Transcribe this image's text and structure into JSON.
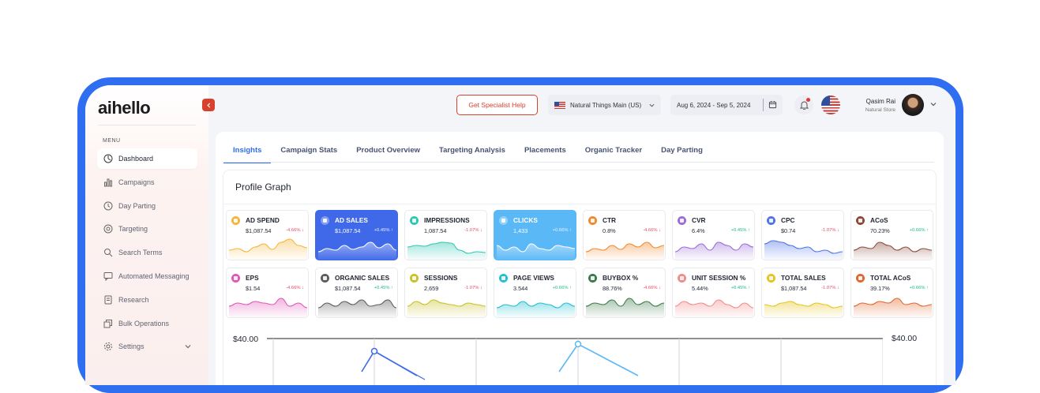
{
  "app": {
    "logo_text": "aihello",
    "collapse_icon": "chevron-left-icon"
  },
  "sidebar": {
    "menu_label": "MENU",
    "items": [
      {
        "label": "Dashboard",
        "icon": "dashboard-icon",
        "active": true
      },
      {
        "label": "Campaigns",
        "icon": "bar-chart-icon"
      },
      {
        "label": "Day Parting",
        "icon": "clock-icon"
      },
      {
        "label": "Targeting",
        "icon": "target-icon"
      },
      {
        "label": "Search Terms",
        "icon": "search-icon"
      },
      {
        "label": "Automated Messaging",
        "icon": "message-icon"
      },
      {
        "label": "Research",
        "icon": "document-icon"
      },
      {
        "label": "Bulk Operations",
        "icon": "layers-icon"
      },
      {
        "label": "Settings",
        "icon": "gear-icon",
        "expandable": true
      }
    ]
  },
  "header": {
    "help_button": "Get Specialist Help",
    "store": {
      "label": "Natural Things Main (US)"
    },
    "date_range": "Aug 6, 2024 - Sep 5, 2024",
    "user": {
      "name": "Qasim Rai",
      "store": "Natural Store"
    }
  },
  "tabs": [
    {
      "label": "Insights",
      "active": true
    },
    {
      "label": "Campaign Stats"
    },
    {
      "label": "Product Overview"
    },
    {
      "label": "Targeting Analysis"
    },
    {
      "label": "Placements"
    },
    {
      "label": "Organic Tracker"
    },
    {
      "label": "Day Parting"
    }
  ],
  "profile_graph": {
    "title": "Profile Graph",
    "metrics": [
      {
        "name": "AD SPEND",
        "value": "$1,087.54",
        "change": "-4.66%",
        "dir": "down",
        "color": "#f5b63b",
        "spark": [
          12,
          14,
          10,
          16,
          20,
          13,
          22,
          26,
          18,
          15
        ]
      },
      {
        "name": "AD SALES",
        "value": "$1,087.54",
        "change": "+0.45%",
        "dir": "up",
        "color": "#ffffff",
        "selected": "blue",
        "spark": [
          10,
          14,
          12,
          18,
          13,
          16,
          22,
          15,
          20,
          12
        ]
      },
      {
        "name": "IMPRESSIONS",
        "value": "1,087.54",
        "change": "-1.07%",
        "dir": "down",
        "color": "#2fc7b3",
        "spark": [
          16,
          18,
          17,
          20,
          22,
          21,
          12,
          8,
          10,
          9
        ]
      },
      {
        "name": "CLICKS",
        "value": "1,433",
        "change": "+0.66%",
        "dir": "up",
        "color": "#ffffff",
        "selected": "light",
        "spark": [
          18,
          12,
          16,
          10,
          20,
          14,
          12,
          18,
          16,
          14
        ]
      },
      {
        "name": "CTR",
        "value": "0.8%",
        "change": "-4.66%",
        "dir": "down",
        "color": "#f08a30",
        "spark": [
          10,
          14,
          12,
          18,
          13,
          20,
          16,
          22,
          15,
          18
        ]
      },
      {
        "name": "CVR",
        "value": "6.4%",
        "change": "+0.45%",
        "dir": "up",
        "color": "#9a6cd6",
        "spark": [
          10,
          16,
          14,
          20,
          12,
          22,
          18,
          12,
          20,
          16
        ]
      },
      {
        "name": "CPC",
        "value": "$0.74",
        "change": "-1.07%",
        "dir": "down",
        "color": "#4f74e8",
        "spark": [
          20,
          24,
          22,
          18,
          14,
          16,
          10,
          12,
          8,
          10
        ]
      },
      {
        "name": "ACoS",
        "value": "70.23%",
        "change": "+0.66%",
        "dir": "up",
        "color": "#8c4a3a",
        "spark": [
          12,
          16,
          14,
          22,
          18,
          12,
          16,
          10,
          14,
          12
        ]
      },
      {
        "name": "EPS",
        "value": "$1.54",
        "change": "-4.66%",
        "dir": "down",
        "color": "#e058b6",
        "spark": [
          14,
          18,
          16,
          20,
          18,
          16,
          24,
          14,
          18,
          12
        ]
      },
      {
        "name": "ORGANIC SALES",
        "value": "$1,087.54",
        "change": "+0.45%",
        "dir": "up",
        "color": "#5c5c5c",
        "spark": [
          12,
          18,
          14,
          20,
          16,
          22,
          14,
          16,
          22,
          12
        ]
      },
      {
        "name": "SESSIONS",
        "value": "2,659",
        "change": "-1.07%",
        "dir": "down",
        "color": "#c9c126",
        "spark": [
          14,
          20,
          16,
          22,
          18,
          16,
          14,
          18,
          16,
          14
        ]
      },
      {
        "name": "PAGE VIEWS",
        "value": "3.544",
        "change": "+0.66%",
        "dir": "up",
        "color": "#22c0d2",
        "spark": [
          12,
          16,
          14,
          20,
          14,
          18,
          16,
          12,
          18,
          14
        ]
      },
      {
        "name": "BUYBOX %",
        "value": "88.76%",
        "change": "-4.66%",
        "dir": "down",
        "color": "#3c7a4a",
        "spark": [
          14,
          18,
          16,
          22,
          14,
          24,
          16,
          20,
          14,
          18
        ]
      },
      {
        "name": "UNIT SESSION %",
        "value": "5.44%",
        "change": "+0.45%",
        "dir": "up",
        "color": "#f48a8a",
        "spark": [
          14,
          20,
          16,
          18,
          14,
          22,
          16,
          12,
          18,
          12
        ]
      },
      {
        "name": "TOTAL SALES",
        "value": "$1,087.54",
        "change": "-1.07%",
        "dir": "down",
        "color": "#e6c520",
        "spark": [
          16,
          14,
          18,
          20,
          16,
          14,
          18,
          16,
          12,
          14
        ]
      },
      {
        "name": "TOTAL ACoS",
        "value": "39.17%",
        "change": "+0.66%",
        "dir": "up",
        "color": "#e0672c",
        "spark": [
          14,
          18,
          16,
          20,
          18,
          24,
          16,
          18,
          14,
          16
        ]
      }
    ],
    "axis_left_top": "$40.00",
    "axis_right_top": "$40.00"
  }
}
